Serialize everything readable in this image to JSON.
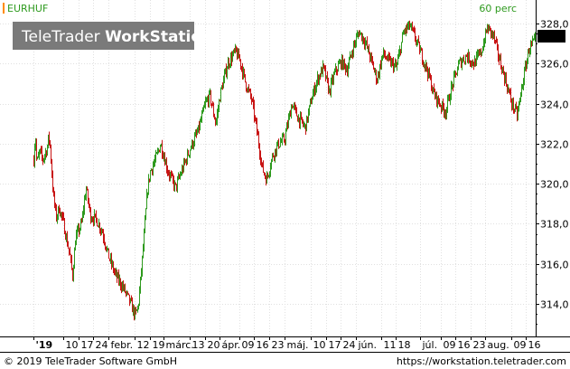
{
  "header": {
    "symbol": "EURHUF",
    "interval": "60 perc"
  },
  "watermark": {
    "brand": "TeleTrader",
    "product": "WorkStation"
  },
  "footer": {
    "copyright": "© 2019 TeleTrader Software GmbH",
    "url": "https://workstation.teletrader.com"
  },
  "colors": {
    "up": "#2e9a1e",
    "down": "#c81414",
    "grid": "#e0e0e0",
    "symbol_marker": "#ff8c00",
    "interval_text": "#2e9a1e",
    "watermark_bg": "#7a7a7a"
  },
  "chart_data": {
    "type": "candlestick",
    "title": "EURHUF",
    "interval": "60 perc",
    "last_value": "327,1",
    "ylim": [
      312.5,
      328.6
    ],
    "y_ticks": [
      "314,0",
      "316,0",
      "318,0",
      "320,0",
      "322,0",
      "324,0",
      "326,0",
      "328,0"
    ],
    "y_tick_values": [
      314,
      316,
      318,
      320,
      322,
      324,
      326,
      328
    ],
    "x_ticks": [
      "'19",
      "10",
      "17",
      "24",
      "febr.",
      "12",
      "19",
      "márc.",
      "13",
      "20",
      "ápr.",
      "09",
      "16",
      "23",
      "máj.",
      "10",
      "17",
      "24",
      "jún.",
      "11",
      "18",
      "júl.",
      "09",
      "16",
      "23",
      "aug.",
      "09",
      "16"
    ],
    "x_tick_index": [
      0,
      2.0,
      3.0,
      4.0,
      5.0,
      6.8,
      7.8,
      8.7,
      10.5,
      11.5,
      12.5,
      13.8,
      14.8,
      15.8,
      16.8,
      18.6,
      19.6,
      20.6,
      21.6,
      23.3,
      24.3,
      25.9,
      27.3,
      28.3,
      29.3,
      30.3,
      32.0,
      33.0
    ],
    "path_anchors": [
      [
        0.0,
        321.2
      ],
      [
        0.1,
        322.5
      ],
      [
        0.2,
        321.0
      ],
      [
        0.4,
        321.6
      ],
      [
        0.6,
        321.2
      ],
      [
        0.9,
        321.8
      ],
      [
        1.0,
        322.4
      ],
      [
        1.1,
        321.8
      ],
      [
        1.3,
        319.5
      ],
      [
        1.5,
        318.3
      ],
      [
        1.7,
        318.8
      ],
      [
        2.0,
        318.0
      ],
      [
        2.2,
        317.2
      ],
      [
        2.4,
        316.5
      ],
      [
        2.6,
        315.4
      ],
      [
        2.8,
        317.3
      ],
      [
        3.2,
        318.0
      ],
      [
        3.5,
        319.8
      ],
      [
        3.8,
        318.4
      ],
      [
        4.2,
        318.2
      ],
      [
        4.6,
        317.6
      ],
      [
        5.0,
        316.4
      ],
      [
        5.5,
        315.4
      ],
      [
        6.0,
        314.8
      ],
      [
        6.5,
        314.0
      ],
      [
        6.8,
        313.4
      ],
      [
        7.0,
        313.9
      ],
      [
        7.2,
        315.6
      ],
      [
        7.4,
        317.5
      ],
      [
        7.6,
        319.6
      ],
      [
        7.8,
        320.6
      ],
      [
        8.2,
        321.3
      ],
      [
        8.5,
        322.0
      ],
      [
        9.0,
        320.6
      ],
      [
        9.5,
        319.8
      ],
      [
        10.0,
        320.8
      ],
      [
        10.5,
        321.8
      ],
      [
        11.0,
        322.6
      ],
      [
        11.5,
        324.0
      ],
      [
        11.8,
        324.4
      ],
      [
        12.2,
        323.0
      ],
      [
        12.5,
        324.5
      ],
      [
        13.0,
        326.0
      ],
      [
        13.5,
        326.6
      ],
      [
        13.8,
        326.2
      ],
      [
        14.2,
        325.0
      ],
      [
        14.6,
        324.2
      ],
      [
        15.0,
        322.4
      ],
      [
        15.3,
        320.8
      ],
      [
        15.6,
        320.2
      ],
      [
        16.0,
        321.4
      ],
      [
        16.4,
        322.0
      ],
      [
        16.8,
        322.2
      ],
      [
        17.3,
        324.0
      ],
      [
        17.7,
        323.3
      ],
      [
        18.2,
        322.8
      ],
      [
        18.6,
        324.2
      ],
      [
        19.0,
        325.2
      ],
      [
        19.4,
        325.8
      ],
      [
        19.8,
        324.6
      ],
      [
        20.2,
        325.6
      ],
      [
        20.6,
        326.1
      ],
      [
        21.0,
        325.7
      ],
      [
        21.4,
        326.8
      ],
      [
        21.8,
        327.6
      ],
      [
        22.2,
        327.1
      ],
      [
        22.6,
        326.2
      ],
      [
        23.0,
        325.2
      ],
      [
        23.4,
        326.5
      ],
      [
        23.8,
        326.1
      ],
      [
        24.3,
        325.8
      ],
      [
        24.8,
        327.6
      ],
      [
        25.2,
        327.9
      ],
      [
        25.6,
        327.2
      ],
      [
        26.0,
        326.4
      ],
      [
        26.4,
        325.6
      ],
      [
        26.8,
        324.5
      ],
      [
        27.2,
        324.0
      ],
      [
        27.6,
        323.6
      ],
      [
        28.0,
        324.8
      ],
      [
        28.5,
        326.0
      ],
      [
        29.0,
        326.4
      ],
      [
        29.5,
        326.0
      ],
      [
        30.0,
        326.6
      ],
      [
        30.4,
        327.8
      ],
      [
        30.8,
        327.4
      ],
      [
        31.2,
        326.2
      ],
      [
        31.6,
        325.2
      ],
      [
        32.0,
        324.1
      ],
      [
        32.4,
        323.4
      ],
      [
        32.8,
        325.2
      ],
      [
        33.2,
        326.8
      ],
      [
        33.6,
        327.1
      ]
    ]
  }
}
